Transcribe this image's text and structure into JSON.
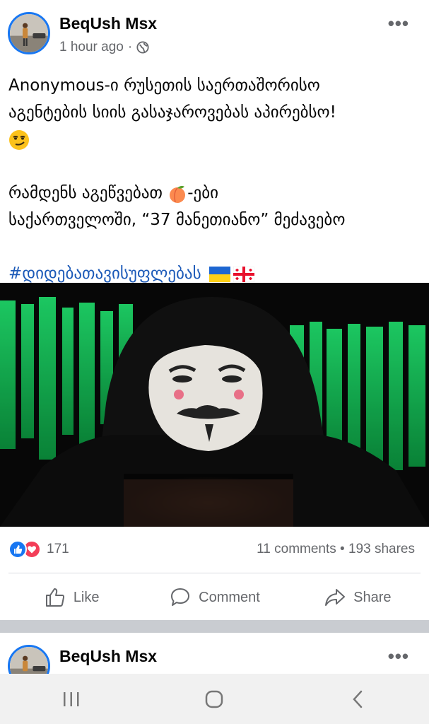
{
  "post": {
    "author": "BeqUsh Msx",
    "time": "1 hour ago",
    "separator": "·",
    "text_line1": "Anonymous-ი რუსეთის საერთაშორისო",
    "text_line2": "აგენტების სიის გასაჯაროვებას აპირებსო!",
    "text_line3": "რამდენს აგეწვებათ ",
    "text_line3b": "-ები",
    "text_line4": "საქართველოში, “37 მანეთიანო” მეძავებო",
    "hashtag": "#დიდებათავისუფლებას",
    "reaction_count": "171",
    "comments": "11 comments",
    "dot": "•",
    "shares": "193 shares"
  },
  "actions": {
    "like": "Like",
    "comment": "Comment",
    "share": "Share"
  },
  "next_post": {
    "author": "BeqUsh Msx"
  },
  "icons": {
    "more": "more-horizontal-icon",
    "globe": "globe-icon",
    "like": "thumbs-up-icon",
    "comment": "comment-bubble-icon",
    "share": "share-arrow-icon"
  },
  "colors": {
    "accent": "#1877f2",
    "love": "#f33e58",
    "hashtag": "#1c5ab8",
    "muted": "#65676b"
  }
}
